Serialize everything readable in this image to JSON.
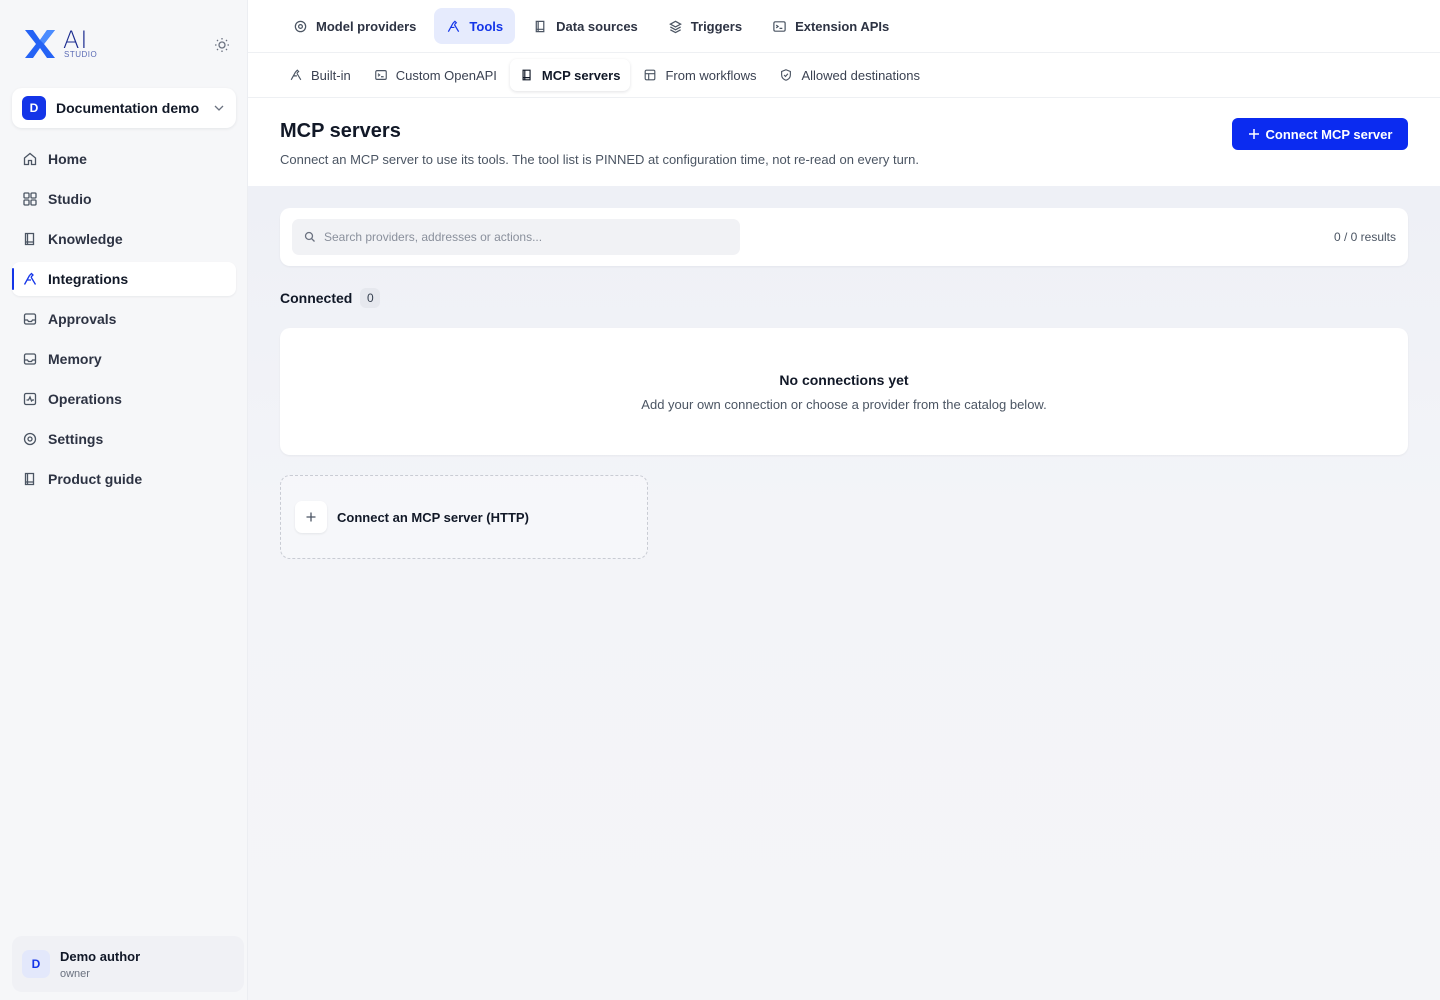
{
  "brand": {
    "name": "AI",
    "sub": "STUDIO",
    "accent": "#1435e8",
    "logo_icon": "x-logo-icon"
  },
  "theme_toggle": {
    "icon": "sun-icon"
  },
  "workspace": {
    "initial": "D",
    "name": "Documentation demo"
  },
  "sidebar": {
    "items": [
      {
        "label": "Home",
        "icon": "home-icon"
      },
      {
        "label": "Studio",
        "icon": "grid-icon"
      },
      {
        "label": "Knowledge",
        "icon": "book-icon"
      },
      {
        "label": "Integrations",
        "icon": "tools-icon",
        "active": true
      },
      {
        "label": "Approvals",
        "icon": "inbox-icon"
      },
      {
        "label": "Memory",
        "icon": "inbox-icon"
      },
      {
        "label": "Operations",
        "icon": "activity-icon"
      },
      {
        "label": "Settings",
        "icon": "gear-icon"
      },
      {
        "label": "Product guide",
        "icon": "book-icon"
      }
    ]
  },
  "user": {
    "initial": "D",
    "name": "Demo author",
    "role": "owner"
  },
  "top_tabs": [
    {
      "label": "Model providers",
      "icon": "target-icon"
    },
    {
      "label": "Tools",
      "icon": "tools-icon",
      "active": true
    },
    {
      "label": "Data sources",
      "icon": "book-icon"
    },
    {
      "label": "Triggers",
      "icon": "layers-icon"
    },
    {
      "label": "Extension APIs",
      "icon": "terminal-icon"
    }
  ],
  "sub_tabs": [
    {
      "label": "Built-in",
      "icon": "tools-icon"
    },
    {
      "label": "Custom OpenAPI",
      "icon": "terminal-icon"
    },
    {
      "label": "MCP servers",
      "icon": "book-icon",
      "active": true
    },
    {
      "label": "From workflows",
      "icon": "table-icon"
    },
    {
      "label": "Allowed destinations",
      "icon": "shield-icon"
    }
  ],
  "page": {
    "title": "MCP servers",
    "description": "Connect an MCP server to use its tools. The tool list is PINNED at configuration time, not re-read on every turn.",
    "primary_button": "Connect MCP server"
  },
  "search": {
    "placeholder": "Search providers, addresses or actions...",
    "value": "",
    "results": "0 / 0 results"
  },
  "connected": {
    "title": "Connected",
    "count": "0"
  },
  "empty": {
    "title": "No connections yet",
    "description": "Add your own connection or choose a provider from the catalog below."
  },
  "connect_card": {
    "label": "Connect an MCP server (HTTP)"
  }
}
